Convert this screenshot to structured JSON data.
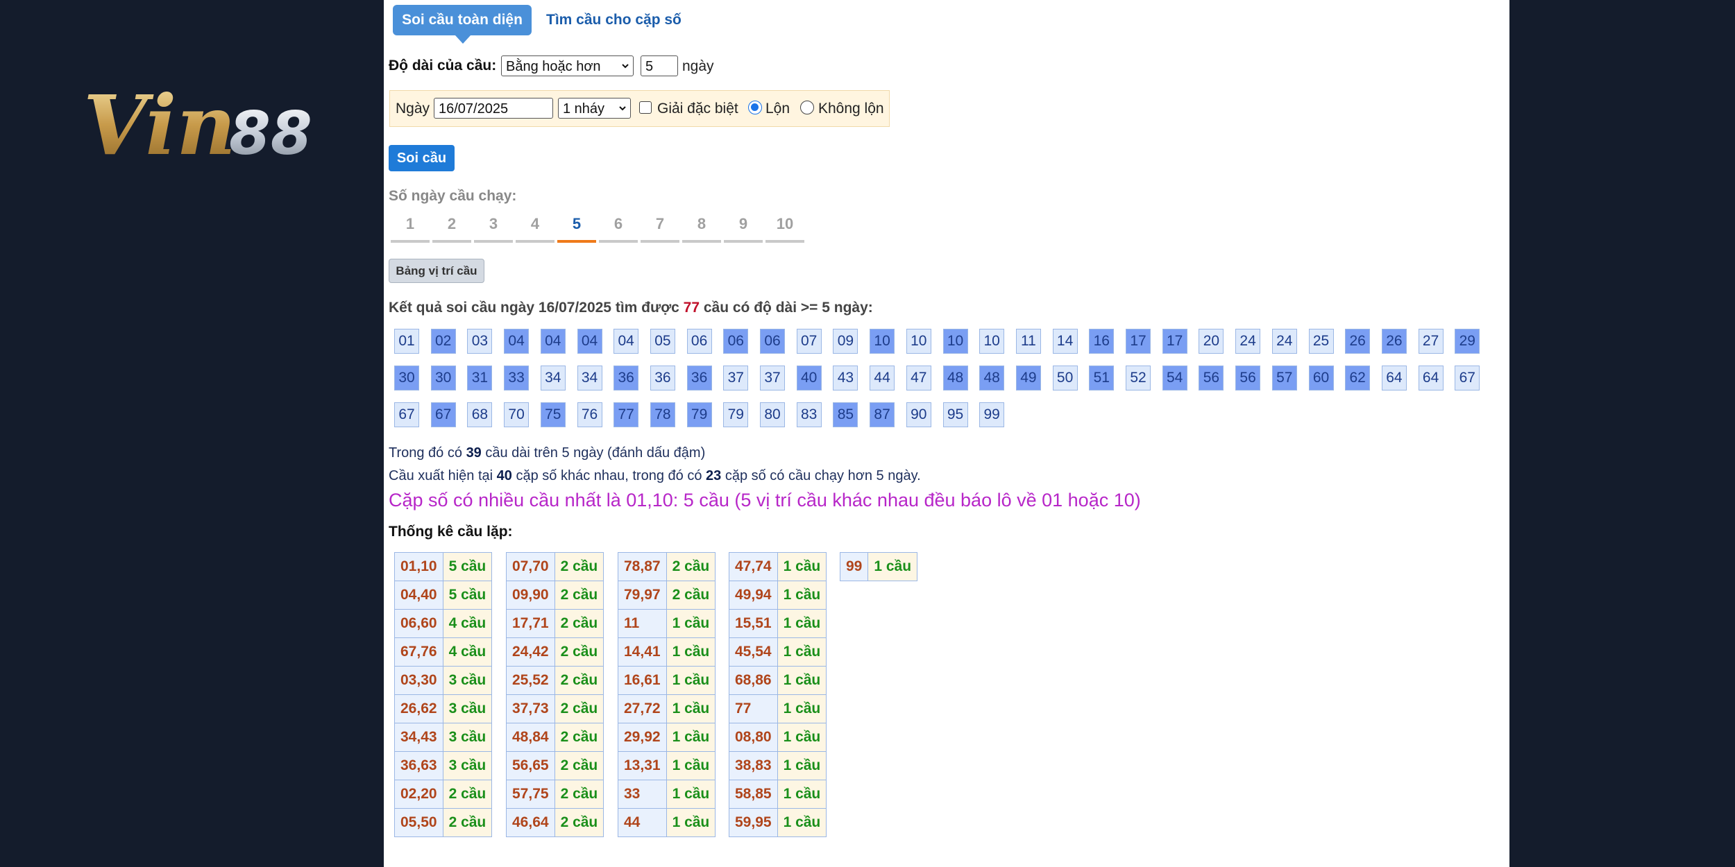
{
  "brand": {
    "logo_text": "Vin88"
  },
  "tabs": {
    "active": "Soi cầu toàn diện",
    "other": "Tìm cầu cho cặp số"
  },
  "length_row": {
    "label": "Độ dài của cầu:",
    "select_value": "Bằng hoặc hơn",
    "days_value": "5",
    "unit": "ngày"
  },
  "filter": {
    "date_label": "Ngày",
    "date_value": "16/07/2025",
    "jump_value": "1 nháy",
    "special_label": "Giải đặc biệt",
    "special_checked": false,
    "radio_lon": "Lộn",
    "radio_khong_lon": "Không lộn",
    "selected": "Lộn"
  },
  "submit_label": "Soi cầu",
  "days_run": {
    "label": "Số ngày cầu chạy:",
    "days": [
      "1",
      "2",
      "3",
      "4",
      "5",
      "6",
      "7",
      "8",
      "9",
      "10"
    ],
    "active": "5"
  },
  "position_button": "Bảng vị trí cầu",
  "result": {
    "prefix": "Kết quả soi cầu ngày 16/07/2025 tìm được",
    "count": "77",
    "suffix": "cầu có độ dài >= 5 ngày:"
  },
  "numbers": [
    {
      "v": "01",
      "s": "light"
    },
    {
      "v": "02",
      "s": "dark"
    },
    {
      "v": "03",
      "s": "light"
    },
    {
      "v": "04",
      "s": "dark"
    },
    {
      "v": "04",
      "s": "dark"
    },
    {
      "v": "04",
      "s": "dark"
    },
    {
      "v": "04",
      "s": "light"
    },
    {
      "v": "05",
      "s": "light"
    },
    {
      "v": "06",
      "s": "light"
    },
    {
      "v": "06",
      "s": "dark"
    },
    {
      "v": "06",
      "s": "dark"
    },
    {
      "v": "07",
      "s": "light"
    },
    {
      "v": "09",
      "s": "light"
    },
    {
      "v": "10",
      "s": "dark"
    },
    {
      "v": "10",
      "s": "light"
    },
    {
      "v": "10",
      "s": "dark"
    },
    {
      "v": "10",
      "s": "light"
    },
    {
      "v": "11",
      "s": "light"
    },
    {
      "v": "14",
      "s": "light"
    },
    {
      "v": "16",
      "s": "dark"
    },
    {
      "v": "17",
      "s": "dark"
    },
    {
      "v": "17",
      "s": "dark"
    },
    {
      "v": "20",
      "s": "light"
    },
    {
      "v": "24",
      "s": "light"
    },
    {
      "v": "24",
      "s": "light"
    },
    {
      "v": "25",
      "s": "light"
    },
    {
      "v": "26",
      "s": "dark"
    },
    {
      "v": "26",
      "s": "dark"
    },
    {
      "v": "27",
      "s": "light"
    },
    {
      "v": "29",
      "s": "dark"
    },
    {
      "v": "30",
      "s": "dark"
    },
    {
      "v": "30",
      "s": "dark"
    },
    {
      "v": "31",
      "s": "dark"
    },
    {
      "v": "33",
      "s": "dark"
    },
    {
      "v": "34",
      "s": "light"
    },
    {
      "v": "34",
      "s": "light"
    },
    {
      "v": "36",
      "s": "dark"
    },
    {
      "v": "36",
      "s": "light"
    },
    {
      "v": "36",
      "s": "dark"
    },
    {
      "v": "37",
      "s": "light"
    },
    {
      "v": "37",
      "s": "light"
    },
    {
      "v": "40",
      "s": "dark"
    },
    {
      "v": "43",
      "s": "light"
    },
    {
      "v": "44",
      "s": "light"
    },
    {
      "v": "47",
      "s": "light"
    },
    {
      "v": "48",
      "s": "dark"
    },
    {
      "v": "48",
      "s": "dark"
    },
    {
      "v": "49",
      "s": "dark"
    },
    {
      "v": "50",
      "s": "light"
    },
    {
      "v": "51",
      "s": "dark"
    },
    {
      "v": "52",
      "s": "light"
    },
    {
      "v": "54",
      "s": "dark"
    },
    {
      "v": "56",
      "s": "dark"
    },
    {
      "v": "56",
      "s": "dark"
    },
    {
      "v": "57",
      "s": "dark"
    },
    {
      "v": "60",
      "s": "dark"
    },
    {
      "v": "62",
      "s": "dark"
    },
    {
      "v": "64",
      "s": "light"
    },
    {
      "v": "64",
      "s": "light"
    },
    {
      "v": "67",
      "s": "light"
    },
    {
      "v": "67",
      "s": "light"
    },
    {
      "v": "67",
      "s": "dark"
    },
    {
      "v": "68",
      "s": "light"
    },
    {
      "v": "70",
      "s": "light"
    },
    {
      "v": "75",
      "s": "dark"
    },
    {
      "v": "76",
      "s": "light"
    },
    {
      "v": "77",
      "s": "dark"
    },
    {
      "v": "78",
      "s": "dark"
    },
    {
      "v": "79",
      "s": "dark"
    },
    {
      "v": "79",
      "s": "light"
    },
    {
      "v": "80",
      "s": "light"
    },
    {
      "v": "83",
      "s": "light"
    },
    {
      "v": "85",
      "s": "dark"
    },
    {
      "v": "87",
      "s": "dark"
    },
    {
      "v": "90",
      "s": "light"
    },
    {
      "v": "95",
      "s": "light"
    },
    {
      "v": "99",
      "s": "light"
    }
  ],
  "summary": {
    "line1_prefix": "Trong đó có",
    "line1_num": "39",
    "line1_suffix": "cầu dài trên 5 ngày (đánh dấu đậm)",
    "line2_prefix": "Cầu xuất hiện tại",
    "line2_num1": "40",
    "line2_mid": "cặp số khác nhau, trong đó có",
    "line2_num2": "23",
    "line2_suffix": "cặp số có cầu chạy hơn 5 ngày.",
    "highlight": "Cặp số có nhiều cầu nhất là 01,10: 5 cầu (5 vị trí cầu khác nhau đều báo lô về 01 hoặc 10)"
  },
  "stats": {
    "title": "Thống kê cầu lặp:",
    "tables": [
      [
        [
          "01,10",
          "5 cầu"
        ],
        [
          "04,40",
          "5 cầu"
        ],
        [
          "06,60",
          "4 cầu"
        ],
        [
          "67,76",
          "4 cầu"
        ],
        [
          "03,30",
          "3 cầu"
        ],
        [
          "26,62",
          "3 cầu"
        ],
        [
          "34,43",
          "3 cầu"
        ],
        [
          "36,63",
          "3 cầu"
        ],
        [
          "02,20",
          "2 cầu"
        ],
        [
          "05,50",
          "2 cầu"
        ]
      ],
      [
        [
          "07,70",
          "2 cầu"
        ],
        [
          "09,90",
          "2 cầu"
        ],
        [
          "17,71",
          "2 cầu"
        ],
        [
          "24,42",
          "2 cầu"
        ],
        [
          "25,52",
          "2 cầu"
        ],
        [
          "37,73",
          "2 cầu"
        ],
        [
          "48,84",
          "2 cầu"
        ],
        [
          "56,65",
          "2 cầu"
        ],
        [
          "57,75",
          "2 cầu"
        ],
        [
          "46,64",
          "2 cầu"
        ]
      ],
      [
        [
          "78,87",
          "2 cầu"
        ],
        [
          "79,97",
          "2 cầu"
        ],
        [
          "11",
          "1 cầu"
        ],
        [
          "14,41",
          "1 cầu"
        ],
        [
          "16,61",
          "1 cầu"
        ],
        [
          "27,72",
          "1 cầu"
        ],
        [
          "29,92",
          "1 cầu"
        ],
        [
          "13,31",
          "1 cầu"
        ],
        [
          "33",
          "1 cầu"
        ],
        [
          "44",
          "1 cầu"
        ]
      ],
      [
        [
          "47,74",
          "1 cầu"
        ],
        [
          "49,94",
          "1 cầu"
        ],
        [
          "15,51",
          "1 cầu"
        ],
        [
          "45,54",
          "1 cầu"
        ],
        [
          "68,86",
          "1 cầu"
        ],
        [
          "77",
          "1 cầu"
        ],
        [
          "08,80",
          "1 cầu"
        ],
        [
          "38,83",
          "1 cầu"
        ],
        [
          "58,85",
          "1 cầu"
        ],
        [
          "59,95",
          "1 cầu"
        ]
      ],
      [
        [
          "99",
          "1 cầu"
        ]
      ]
    ]
  },
  "colors": {
    "background": "#141c2c",
    "panel": "#ffffff",
    "tab_active": "#4a90d9",
    "cell_dark": "#7a9ef3",
    "cell_light": "#dde9fb",
    "highlight": "#b726c8",
    "day_active": "#ef7a1a"
  },
  "icons": [
    "chevron-down-icon",
    "checkbox-icon",
    "radio-icon"
  ]
}
